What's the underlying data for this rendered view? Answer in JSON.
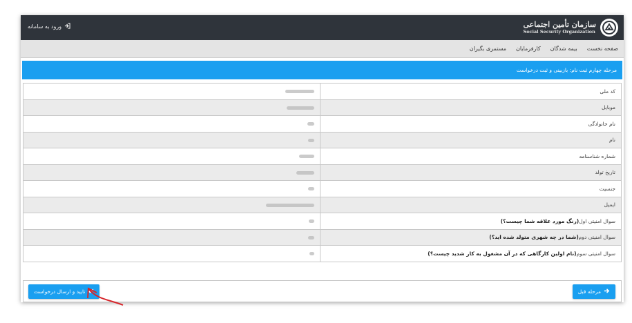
{
  "header": {
    "logo_title": "سازمان تأمین اجتماعی",
    "logo_subtitle": "Social Security Organization",
    "login_label": "ورود به سامانه",
    "login_icon": "sign-in-icon"
  },
  "nav": {
    "items": [
      {
        "label": "صفحه نخست"
      },
      {
        "label": "بیمه شدگان"
      },
      {
        "label": "کارفرمایان"
      },
      {
        "label": "مستمری بگیران"
      }
    ]
  },
  "step": {
    "title": "مرحله چهارم ثبت نام: بازبینی و ثبت درخواست"
  },
  "fields": [
    {
      "label": "کد ملی",
      "value": "redacted"
    },
    {
      "label": "موبایل",
      "value": "redacted"
    },
    {
      "label": "نام خانوادگی",
      "value": "redacted"
    },
    {
      "label": "نام",
      "value": "redacted"
    },
    {
      "label": "شماره شناسنامه",
      "value": "redacted"
    },
    {
      "label": "تاریخ تولد",
      "value": "redacted"
    },
    {
      "label": "جنسیت",
      "value": "redacted"
    },
    {
      "label": "ایمیل",
      "value": "redacted"
    }
  ],
  "questions": [
    {
      "prefix": "سوال امنیتی اول",
      "question": "(رنگ مورد علاقه شما چیست؟)"
    },
    {
      "prefix": "سوال امنیتی دوم",
      "question": "(شما در چه شهری متولد شده اید؟)"
    },
    {
      "prefix": "سوال امنیتی سوم",
      "question": "(نام اولین کارگاهی که در آن مشغول به کار شدید چیست؟)"
    }
  ],
  "buttons": {
    "prev_label": "مرحله قبل",
    "submit_label": "تایید و ارسال درخواست"
  },
  "colors": {
    "accent": "#1a9ff0",
    "topbar": "#2f343b",
    "annotation_arrow": "#d6262b"
  }
}
